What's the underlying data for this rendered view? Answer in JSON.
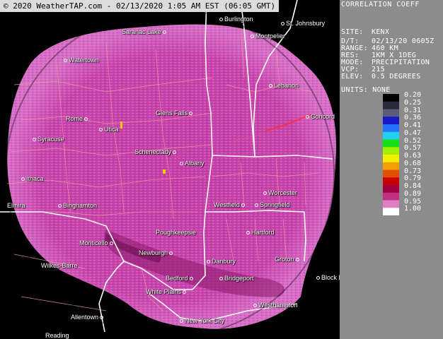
{
  "copyright": "© 2020 WeatherTAP.com - 02/13/2020  1:05 AM EST (06:05 GMT)",
  "product_title": "CORRELATION COEFF",
  "info": [
    {
      "key": "SITE:",
      "value": "KENX"
    },
    {
      "key": "D/T:",
      "value": "02/13/20 0605Z"
    },
    {
      "key": "RANGE:",
      "value": "460 KM"
    },
    {
      "key": "RES:",
      "value": "1KM X 1DEG"
    },
    {
      "key": "MODE:",
      "value": "PRECIPITATION"
    },
    {
      "key": "VCP:",
      "value": "215"
    },
    {
      "key": "ELEV:",
      "value": "0.5 DEGREES"
    }
  ],
  "units_label": "UNITS: NONE",
  "scale": {
    "labels": [
      "0.20",
      "0.25",
      "0.31",
      "0.36",
      "0.41",
      "0.47",
      "0.52",
      "0.57",
      "0.63",
      "0.68",
      "0.73",
      "0.79",
      "0.84",
      "0.89",
      "0.95",
      "1.00"
    ],
    "colors": [
      "#000000",
      "#2a2a3a",
      "#5a5a7a",
      "#1818c8",
      "#2870ff",
      "#20d0f0",
      "#18e018",
      "#a0f000",
      "#f0f000",
      "#f0a000",
      "#e05000",
      "#c80000",
      "#a00040",
      "#c03080",
      "#e080c0",
      "#ffffff"
    ]
  },
  "colors": {
    "echo": "#c040a8",
    "echo_light": "#d868c8",
    "border": "#ffffff",
    "county": "#f0a0a0",
    "panel_bg": "#8c8c8c"
  },
  "cities": [
    {
      "name": "Burlington"
    },
    {
      "name": "St. Johnsbury"
    },
    {
      "name": "Saranac Lake"
    },
    {
      "name": "Montpelier"
    },
    {
      "name": "Watertown"
    },
    {
      "name": "Lebanon"
    },
    {
      "name": "Glens Falls"
    },
    {
      "name": "Rome"
    },
    {
      "name": "Utica"
    },
    {
      "name": "Concord"
    },
    {
      "name": "Syracuse"
    },
    {
      "name": "Schenectady"
    },
    {
      "name": "Albany"
    },
    {
      "name": "Ithaca"
    },
    {
      "name": "Worcester"
    },
    {
      "name": "Binghamton"
    },
    {
      "name": "Elmira"
    },
    {
      "name": "Westfield"
    },
    {
      "name": "Springfield"
    },
    {
      "name": "Poughkeepsie"
    },
    {
      "name": "Hartford"
    },
    {
      "name": "Monticello"
    },
    {
      "name": "Newburgh"
    },
    {
      "name": "Danbury"
    },
    {
      "name": "Groton"
    },
    {
      "name": "Wilkes-Barre"
    },
    {
      "name": "Bedford"
    },
    {
      "name": "Bridgeport"
    },
    {
      "name": "Block I"
    },
    {
      "name": "White Plains"
    },
    {
      "name": "Westhampton"
    },
    {
      "name": "Allentown"
    },
    {
      "name": "New York City"
    },
    {
      "name": "Reading"
    }
  ]
}
